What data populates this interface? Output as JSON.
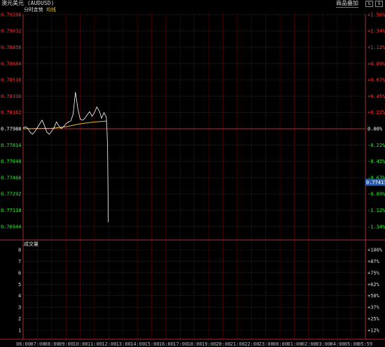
{
  "window": {
    "title": "澳元美元 (AUDUSD)",
    "add_button": "商品叠加",
    "buttons": [
      "G",
      "X"
    ]
  },
  "price_panel": {
    "tabs": [
      "分时走势",
      "均线"
    ],
    "current_price_tag": "0.77417",
    "left_labels": [
      "0.79206",
      "0.79032",
      "0.78858",
      "0.78684",
      "0.78510",
      "0.78336",
      "0.78162",
      "0.77988",
      "0.77814",
      "0.77640",
      "0.77466",
      "0.77292",
      "0.77118",
      "0.76944"
    ],
    "right_labels": [
      "+1.56%",
      "+1.34%",
      "+1.12%",
      "+0.89%",
      "+0.67%",
      "+0.45%",
      "+0.22%",
      "0.00%",
      "-0.22%",
      "-0.45%",
      "-0.67%",
      "-0.89%",
      "-1.12%",
      "-1.34%"
    ]
  },
  "volume_panel": {
    "title": "成交量",
    "left_labels": [
      "8",
      "7",
      "6",
      "5",
      "4",
      "3",
      "2",
      "1"
    ],
    "right_labels": [
      "+100%",
      "+87%",
      "+75%",
      "+62%",
      "+50%",
      "+37%",
      "+25%",
      "+12%"
    ]
  },
  "time_axis": [
    "06:00",
    "07:00",
    "08:00",
    "09:00",
    "10:00",
    "11:00",
    "12:00",
    "13:00",
    "14:00",
    "15:00",
    "16:00",
    "17:00",
    "18:00",
    "19:00",
    "20:00",
    "21:00",
    "22:00",
    "23:00",
    "00:00",
    "01:00",
    "02:00",
    "03:00",
    "04:00",
    "05:00",
    "05:59"
  ],
  "colors": {
    "grid": "#7a1818",
    "axis": "#a03030",
    "up": "#ff3333",
    "down": "#33ee33",
    "flat": "#ffffff",
    "price_line": "#ffffff",
    "avg_line": "#e8c020",
    "price_tag_bg": "#2a5db0"
  },
  "chart_data": {
    "type": "line",
    "series": [
      {
        "name": "分时走势",
        "x": [
          "06:00",
          "06:10",
          "06:20",
          "06:30",
          "06:40",
          "06:50",
          "07:00",
          "07:10",
          "07:20",
          "07:30",
          "07:40",
          "07:50",
          "08:00",
          "08:10",
          "08:20",
          "08:30",
          "08:40",
          "08:50",
          "09:00",
          "09:10",
          "09:20",
          "09:30",
          "09:40",
          "09:50",
          "10:00",
          "10:10",
          "10:20",
          "10:30",
          "10:40",
          "10:50",
          "11:00",
          "11:10",
          "11:20",
          "11:30",
          "11:40",
          "11:50",
          "11:52",
          "11:55",
          "11:58"
        ],
        "values": [
          0.77995,
          0.7801,
          0.7799,
          0.7795,
          0.7793,
          0.7796,
          0.78,
          0.7804,
          0.7808,
          0.7802,
          0.7795,
          0.7793,
          0.7796,
          0.78,
          0.7806,
          0.7802,
          0.7799,
          0.7801,
          0.7804,
          0.7806,
          0.7807,
          0.7814,
          0.7838,
          0.782,
          0.7809,
          0.7808,
          0.781,
          0.7814,
          0.7817,
          0.7812,
          0.7816,
          0.7822,
          0.7818,
          0.781,
          0.7816,
          0.7811,
          0.7802,
          0.778,
          0.7699
        ]
      },
      {
        "name": "均线",
        "x": [
          "06:00",
          "07:00",
          "08:00",
          "09:00",
          "10:00",
          "11:00",
          "11:52"
        ],
        "values": [
          0.77988,
          0.7799,
          0.77992,
          0.7801,
          0.7804,
          0.7806,
          0.7807
        ]
      }
    ],
    "ylim": [
      0.76944,
      0.79206
    ],
    "ylabel_right": "%",
    "grid": true
  }
}
